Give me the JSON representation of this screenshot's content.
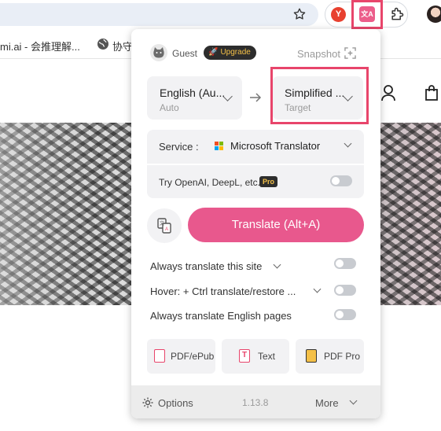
{
  "browser": {
    "bookmarks": [
      "mi.ai - 会推理解...",
      "协守"
    ],
    "yandex_letter": "Y"
  },
  "popup": {
    "guest_label": "Guest",
    "upgrade_label": "Upgrade",
    "snapshot_label": "Snapshot",
    "source_lang": {
      "name": "English (Au...",
      "sub": "Auto"
    },
    "target_lang": {
      "name": "Simplified ...",
      "sub": "Target"
    },
    "service": {
      "label": "Service :",
      "value": "Microsoft Translator",
      "try_label": "Try OpenAI, DeepL, etc.",
      "pro_badge": "Pro",
      "try_enabled": false
    },
    "translate_button": "Translate (Alt+A)",
    "options": [
      {
        "label": "Always translate this site",
        "enabled": false
      },
      {
        "label": "Hover:  + Ctrl translate/restore ...",
        "enabled": false
      },
      {
        "label": "Always translate English pages",
        "enabled": false
      }
    ],
    "tools": [
      {
        "label": "PDF/ePub",
        "icon": "pdf-icon"
      },
      {
        "label": "Text",
        "icon": "text-icon",
        "glyph": "T"
      },
      {
        "label": "PDF Pro",
        "icon": "pdf-pro-icon"
      }
    ],
    "footer": {
      "options_label": "Options",
      "version": "1.13.8",
      "more_label": "More"
    }
  },
  "colors": {
    "accent": "#e8588d",
    "highlight": "#e8456b",
    "panel": "#f2f2f4"
  }
}
